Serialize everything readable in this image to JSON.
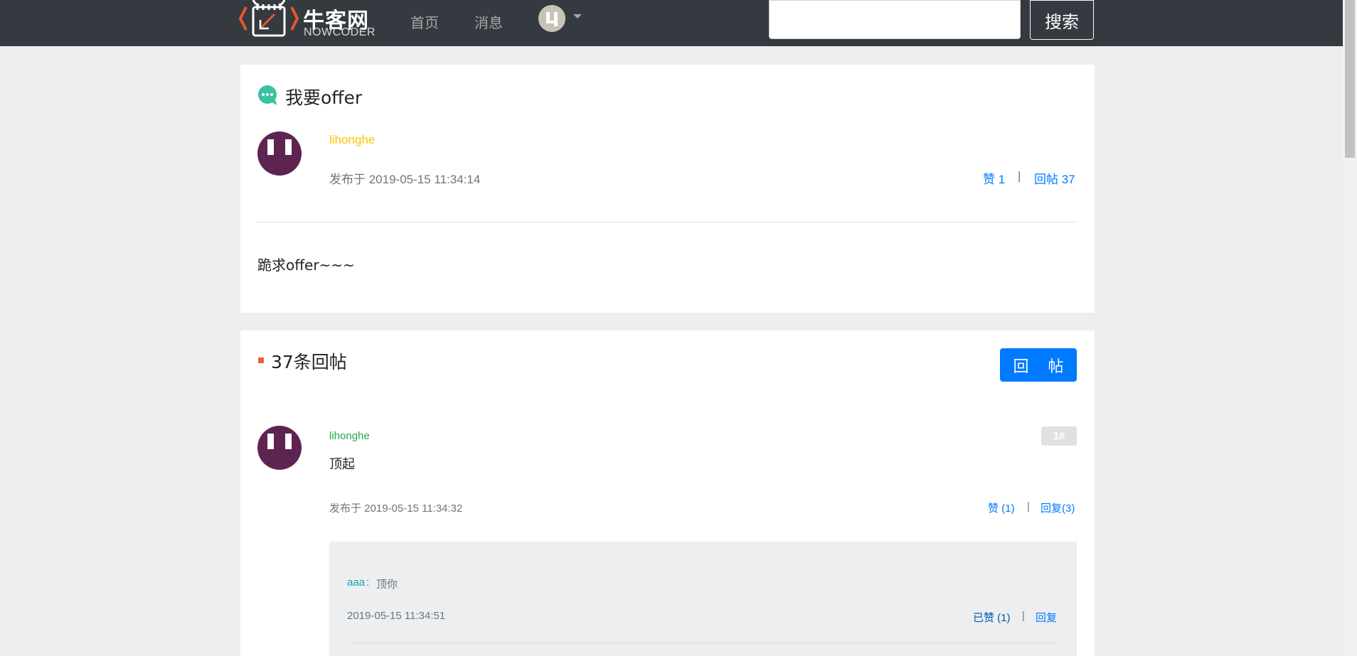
{
  "header": {
    "logo_text": "牛客网",
    "logo_sub": "NOWCODER",
    "nav_home": "首页",
    "nav_messages": "消息",
    "search_value": "",
    "search_button": "搜索"
  },
  "post": {
    "title": "我要offer",
    "author": "lihonghe",
    "published": "发布于 2019-05-15 11:34:14",
    "like_label": "赞 1",
    "reply_count_label": "回帖 37",
    "separator": "|",
    "body": "跪求offer~~~"
  },
  "replies": {
    "section_title": "37条回帖",
    "reply_button": "回 帖",
    "items": [
      {
        "floor": "1#",
        "author": "lihonghe",
        "content": "顶起",
        "published": "发布于 2019-05-15 11:34:32",
        "like_label": "赞 (1)",
        "reply_label": "回复(3)",
        "separator": "|",
        "comments": [
          {
            "user": "aaa",
            "colon": ":",
            "text": "顶你",
            "time": "2019-05-15 11:34:51",
            "liked_label": "已赞 (1)",
            "reply_label": "回复",
            "separator": "|"
          }
        ]
      }
    ]
  },
  "colors": {
    "navbar": "#343a40",
    "primary": "#007bff",
    "author_orange": "#ffc107",
    "author_green": "#28a745",
    "comment_user": "#17a2b8",
    "accent_mark": "#f25d3d",
    "title_icon": "#3cc1a5"
  }
}
